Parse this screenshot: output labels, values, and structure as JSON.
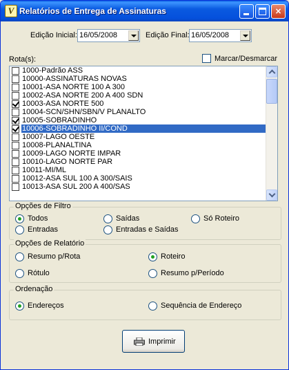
{
  "window": {
    "title": "Relatórios de Entrega de Assinaturas",
    "app_icon_glyph": "V",
    "controls": {
      "minimize": "minimize-icon",
      "maximize": "maximize-icon",
      "close": "×"
    }
  },
  "dates": {
    "initial_label": "Edição Inicial:",
    "initial_value": "16/05/2008",
    "final_label": "Edição Final:",
    "final_value": "16/05/2008"
  },
  "routes": {
    "label": "Rota(s):",
    "toggle_all_label": "Marcar/Desmarcar",
    "toggle_all_checked": false,
    "items": [
      {
        "label": "1000-Padrão ASS",
        "checked": false,
        "selected": false
      },
      {
        "label": "10000-ASSINATURAS NOVAS",
        "checked": false,
        "selected": false
      },
      {
        "label": "10001-ASA NORTE 100 A 300",
        "checked": false,
        "selected": false
      },
      {
        "label": "10002-ASA NORTE 200 A 400 SDN",
        "checked": false,
        "selected": false
      },
      {
        "label": "10003-ASA NORTE 500",
        "checked": true,
        "selected": false
      },
      {
        "label": "10004-SCN/SHN/SBN/V PLANALTO",
        "checked": false,
        "selected": false
      },
      {
        "label": "10005-SOBRADINHO",
        "checked": true,
        "selected": false
      },
      {
        "label": "10006-SOBRADINHO II/COND",
        "checked": true,
        "selected": true
      },
      {
        "label": "10007-LAGO OESTE",
        "checked": false,
        "selected": false
      },
      {
        "label": "10008-PLANALTINA",
        "checked": false,
        "selected": false
      },
      {
        "label": "10009-LAGO NORTE IMPAR",
        "checked": false,
        "selected": false
      },
      {
        "label": "10010-LAGO NORTE PAR",
        "checked": false,
        "selected": false
      },
      {
        "label": "10011-MI/ML",
        "checked": false,
        "selected": false
      },
      {
        "label": "10012-ASA SUL 100 A 300/SAIS",
        "checked": false,
        "selected": false
      },
      {
        "label": "10013-ASA SUL 200 A 400/SAS",
        "checked": false,
        "selected": false
      }
    ]
  },
  "filter": {
    "title": "Opções de Filtro",
    "options": [
      {
        "label": "Todos",
        "checked": true
      },
      {
        "label": "Saídas",
        "checked": false
      },
      {
        "label": "Só Roteiro",
        "checked": false
      },
      {
        "label": "Entradas",
        "checked": false
      },
      {
        "label": "Entradas e Saídas",
        "checked": false
      }
    ]
  },
  "report": {
    "title": "Opções de Relatório",
    "options": [
      {
        "label": "Resumo p/Rota",
        "checked": false
      },
      {
        "label": "Roteiro",
        "checked": true
      },
      {
        "label": "Rótulo",
        "checked": false
      },
      {
        "label": "Resumo p/Período",
        "checked": false
      }
    ]
  },
  "ordering": {
    "title": "Ordenação",
    "options": [
      {
        "label": "Endereços",
        "checked": true
      },
      {
        "label": "Sequência de Endereço",
        "checked": false
      }
    ]
  },
  "print_button": {
    "label": "Imprimir",
    "icon": "printer-icon"
  },
  "colors": {
    "selection": "#316ac5",
    "titlebar": "#0a5ae0",
    "check": "#21a121"
  }
}
